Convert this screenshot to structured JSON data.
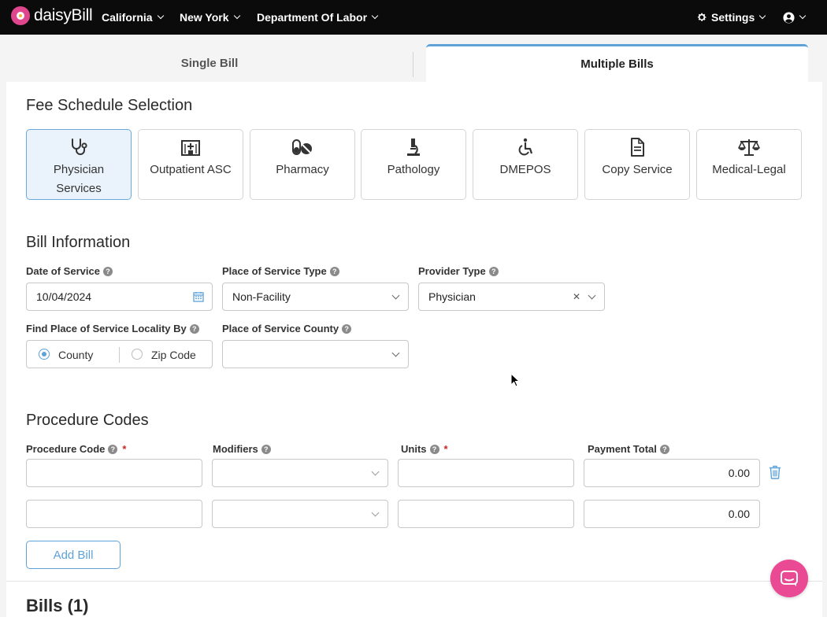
{
  "nav": {
    "brand": "daisyBill",
    "state": "California",
    "city": "New York",
    "agency": "Department Of Labor",
    "settings": "Settings"
  },
  "tabs": {
    "single": "Single Bill",
    "multiple": "Multiple Bills"
  },
  "fee_schedule": {
    "title": "Fee Schedule Selection",
    "options": [
      {
        "label": "Physician Services",
        "icon": "stethoscope-icon"
      },
      {
        "label": "Outpatient ASC",
        "icon": "hospital-icon"
      },
      {
        "label": "Pharmacy",
        "icon": "pills-icon"
      },
      {
        "label": "Pathology",
        "icon": "microscope-icon"
      },
      {
        "label": "DMEPOS",
        "icon": "wheelchair-icon"
      },
      {
        "label": "Copy Service",
        "icon": "document-icon"
      },
      {
        "label": "Medical-Legal",
        "icon": "scales-icon"
      }
    ],
    "selected": "Physician Services"
  },
  "bill_info": {
    "title": "Bill Information",
    "date_label": "Date of Service",
    "date_value": "10/04/2024",
    "pos_type_label": "Place of Service Type",
    "pos_type_value": "Non-Facility",
    "provider_label": "Provider Type",
    "provider_value": "Physician",
    "locality_label": "Find Place of Service Locality By",
    "locality_options": [
      "County",
      "Zip Code"
    ],
    "locality_selected": "County",
    "county_label": "Place of Service County",
    "county_value": ""
  },
  "procedures": {
    "title": "Procedure Codes",
    "headers": {
      "code": "Procedure Code",
      "modifiers": "Modifiers",
      "units": "Units",
      "payment": "Payment Total"
    },
    "rows": [
      {
        "code": "",
        "modifiers": "",
        "units": "",
        "payment": "0.00"
      },
      {
        "code": "",
        "modifiers": "",
        "units": "",
        "payment": "0.00"
      }
    ],
    "add_button": "Add Bill"
  },
  "bills": {
    "title": "Bills (1)"
  },
  "colors": {
    "accent": "#5ea2d8",
    "brand": "#e0468e",
    "chat": "#e94a93",
    "nav_bg": "#0b0b0b"
  }
}
